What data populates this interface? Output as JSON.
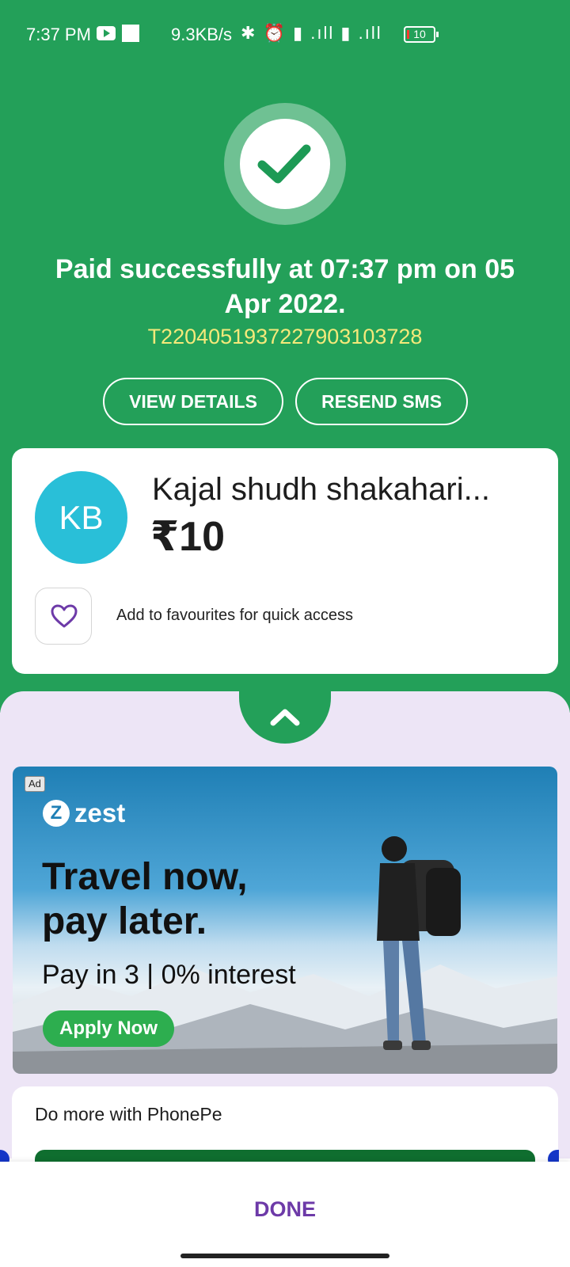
{
  "status_bar": {
    "time": "7:37 PM",
    "speed": "9.3KB/s",
    "icons": "✱ ⏰ ▮ .ıll ▮ .ıll",
    "battery": "10"
  },
  "payment": {
    "message": "Paid successfully at 07:37 pm on 05 Apr 2022.",
    "transaction_id": "T2204051937227903103728",
    "view_details_label": "VIEW DETAILS",
    "resend_sms_label": "RESEND SMS"
  },
  "merchant": {
    "initials": "KB",
    "name": "Kajal shudh shakahari...",
    "amount": "₹10",
    "favourite_text": "Add to favourites for quick access"
  },
  "ad": {
    "label": "Ad",
    "brand_mark": "Z",
    "brand": "zest",
    "headline": "Travel now,\npay later.",
    "subline": "Pay in 3 | 0% interest",
    "cta": "Apply Now"
  },
  "more": {
    "title": "Do more with PhonePe"
  },
  "footer": {
    "done_label": "DONE"
  },
  "colors": {
    "primary_green": "#23a059",
    "accent_purple": "#6d3aa8",
    "avatar_cyan": "#29bfd8",
    "txn_yellow": "#f4e97a"
  }
}
